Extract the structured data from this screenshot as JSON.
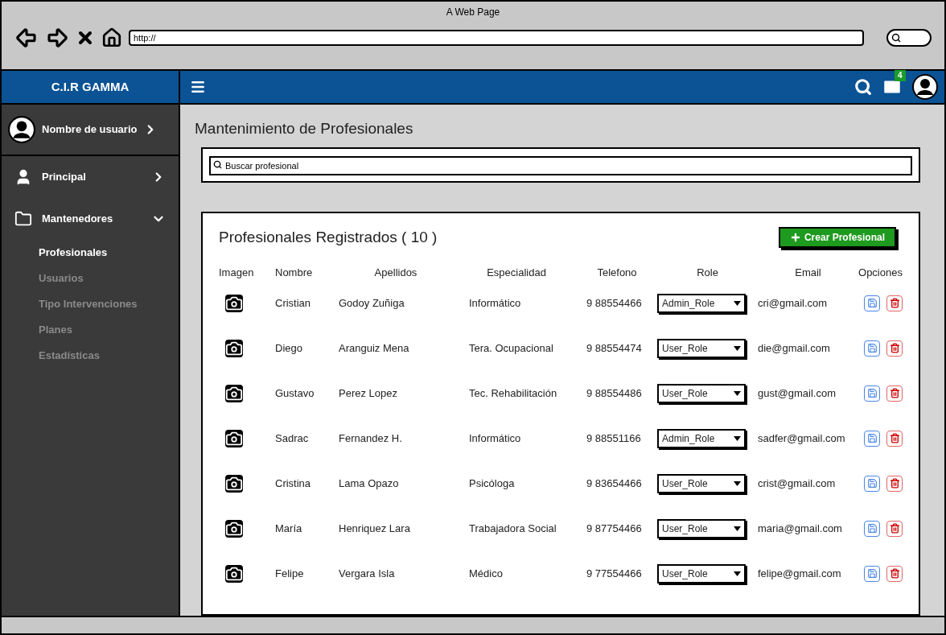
{
  "browser": {
    "title": "A Web Page",
    "url": "http://"
  },
  "topbar": {
    "brand": "C.I.R GAMMA",
    "mail_badge": "4"
  },
  "sidebar": {
    "user": "Nombre de usuario",
    "items": [
      {
        "label": "Principal",
        "kind": "person",
        "expanded": false
      },
      {
        "label": "Mantenedores",
        "kind": "folder",
        "expanded": true,
        "children": [
          {
            "label": "Profesionales",
            "selected": true
          },
          {
            "label": "Usuarios",
            "selected": false
          },
          {
            "label": "Tipo Intervenciones",
            "selected": false
          },
          {
            "label": "Planes",
            "selected": false
          },
          {
            "label": "Estadísticas",
            "selected": false
          }
        ]
      }
    ]
  },
  "page": {
    "title": "Mantenimiento de Profesionales",
    "search": {
      "placeholder": "Buscar profesional"
    }
  },
  "table": {
    "title": "Profesionales Registrados ( 10 )",
    "create_button": "Crear Profesional",
    "columns": [
      "Imagen",
      "Nombre",
      "Apellidos",
      "Especialidad",
      "Telefono",
      "Role",
      "Email",
      "Opciones"
    ],
    "rows": [
      {
        "nombre": "Cristian",
        "apellidos": "Godoy Zuñiga",
        "especialidad": "Informático",
        "telefono": "9 88554466",
        "role": "Admin_Role",
        "email": "cri@gmail.com"
      },
      {
        "nombre": "Diego",
        "apellidos": "Aranguiz Mena",
        "especialidad": "Tera. Ocupacional",
        "telefono": "9 88554474",
        "role": "User_Role",
        "email": "die@gmail.com"
      },
      {
        "nombre": "Gustavo",
        "apellidos": "Perez Lopez",
        "especialidad": "Tec. Rehabilitación",
        "telefono": "9 88554486",
        "role": "User_Role",
        "email": "gust@gmail.com"
      },
      {
        "nombre": "Sadrac",
        "apellidos": "Fernandez H.",
        "especialidad": "Informático",
        "telefono": "9 88551166",
        "role": "Admin_Role",
        "email": "sadfer@gmail.com"
      },
      {
        "nombre": "Cristina",
        "apellidos": "Lama Opazo",
        "especialidad": "Psicóloga",
        "telefono": "9 83654466",
        "role": "User_Role",
        "email": "crist@gmail.com"
      },
      {
        "nombre": "María",
        "apellidos": "Henriquez Lara",
        "especialidad": "Trabajadora Social",
        "telefono": "9 87754466",
        "role": "User_Role",
        "email": "maria@gmail.com"
      },
      {
        "nombre": "Felipe",
        "apellidos": "Vergara Isla",
        "especialidad": "Médico",
        "telefono": "9 77554466",
        "role": "User_Role",
        "email": "felipe@gmail.com"
      }
    ]
  }
}
